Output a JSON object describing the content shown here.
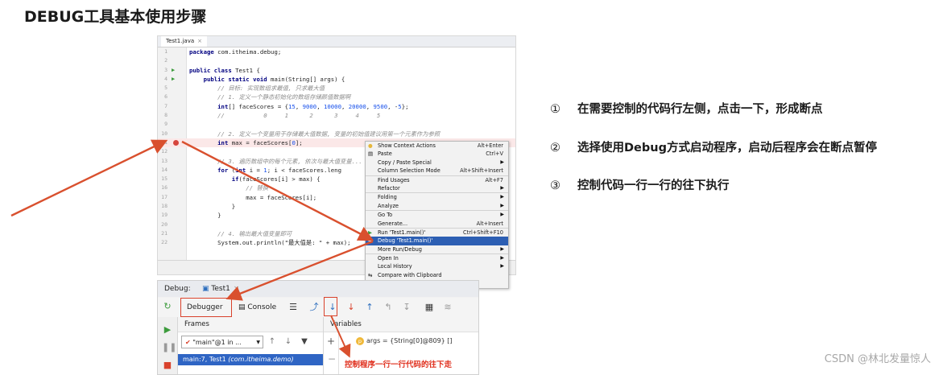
{
  "title": "DEBUG工具基本使用步骤",
  "ide": {
    "tab": "Test1.java",
    "lines": [
      {
        "n": "1",
        "html": "<span class=\"kw\">package</span> com.itheima.debug;"
      },
      {
        "n": "2",
        "html": ""
      },
      {
        "n": "3",
        "html": "<span class=\"kw\">public class</span> Test1 {",
        "run": true
      },
      {
        "n": "4",
        "html": "    <span class=\"kw\">public static void</span> main(String[] args) {",
        "run": true
      },
      {
        "n": "5",
        "html": "        <span class=\"cm\">// 目标: 实现数组求最值, 只求最大值</span>"
      },
      {
        "n": "6",
        "html": "        <span class=\"cm\">// 1. 定义一个静态初始化的数组存储颜值数据啊</span>"
      },
      {
        "n": "7",
        "html": "        <span class=\"kw\">int</span>[] faceScores = {<span class=\"num\">15</span>, <span class=\"num\">9000</span>, <span class=\"num\">10000</span>, <span class=\"num\">20000</span>, <span class=\"num\">9500</span>, -<span class=\"num\">5</span>};"
      },
      {
        "n": "8",
        "html": "        <span class=\"cm\">//           0     1      2      3     4     5</span>"
      },
      {
        "n": "9",
        "html": ""
      },
      {
        "n": "10",
        "html": "        <span class=\"cm\">// 2. 定义一个变量用于存储最大值数据, 变量的初始值建议用第一个元素作为参照</span>"
      },
      {
        "n": "11",
        "html": "        <span class=\"kw\">int</span> <span class=\"hl\">max</span> = faceScores[<span class=\"num\">0</span>];",
        "bp": true
      },
      {
        "n": "12",
        "html": ""
      },
      {
        "n": "13",
        "html": "        <span class=\"cm\">// 3. 遍历数组中的每个元素, 依次与最大值变量...</span>"
      },
      {
        "n": "14",
        "html": "        <span class=\"kw\">for</span> (<span class=\"kw\">int</span> i = <span class=\"num\">1</span>; i < faceScores.leng"
      },
      {
        "n": "15",
        "html": "            <span class=\"kw\">if</span>(faceScores[i] > max) {"
      },
      {
        "n": "16",
        "html": "                <span class=\"cm\">// 替换</span>"
      },
      {
        "n": "17",
        "html": "                max = faceScores[i];"
      },
      {
        "n": "18",
        "html": "            }"
      },
      {
        "n": "19",
        "html": "        }"
      },
      {
        "n": "20",
        "html": ""
      },
      {
        "n": "21",
        "html": "        <span class=\"cm\">// 4. 输出最大值变量即可</span>"
      },
      {
        "n": "22",
        "html": "        System.out.println(\"最大值是: \" + max);"
      }
    ]
  },
  "context_menu": [
    {
      "label": "Show Context Actions",
      "shortcut": "Alt+Enter",
      "icon": "bulb-icon"
    },
    {
      "label": "Paste",
      "shortcut": "Ctrl+V",
      "icon": "paste-icon"
    },
    {
      "label": "Copy / Paste Special",
      "arrow": true
    },
    {
      "label": "Column Selection Mode",
      "shortcut": "Alt+Shift+Insert"
    },
    {
      "label": "Find Usages",
      "shortcut": "Alt+F7",
      "sep": true
    },
    {
      "label": "Refactor",
      "arrow": true
    },
    {
      "label": "Folding",
      "arrow": true,
      "sep": true
    },
    {
      "label": "Analyze",
      "arrow": true
    },
    {
      "label": "Go To",
      "arrow": true,
      "sep": true
    },
    {
      "label": "Generate...",
      "shortcut": "Alt+Insert"
    },
    {
      "label": "Run 'Test1.main()'",
      "shortcut": "Ctrl+Shift+F10",
      "icon": "run-icon",
      "sep": true
    },
    {
      "label": "Debug 'Test1.main()'",
      "selected": true,
      "icon": "debug-icon"
    },
    {
      "label": "More Run/Debug",
      "arrow": true
    },
    {
      "label": "Open In",
      "arrow": true,
      "sep": true
    },
    {
      "label": "Local History",
      "arrow": true
    },
    {
      "label": "Compare with Clipboard",
      "icon": "compare-icon"
    }
  ],
  "debug_panel": {
    "label": "Debug:",
    "tab": "Test1",
    "debugger_tab": "Debugger",
    "console_tab": "Console",
    "frames_header": "Frames",
    "variables_header": "Variables",
    "thread": "\"main\"@1 in ...",
    "frame_row": "main:7, Test1",
    "frame_row_pkg": "(com.itheima.demo)",
    "var_badge": "p",
    "var_row": "args = {String[0]@809} []"
  },
  "annotation": "控制程序一行一行代码的往下走",
  "steps": [
    {
      "num": "①",
      "text": "在需要控制的代码行左侧，点击一下，形成断点"
    },
    {
      "num": "②",
      "text": "选择使用Debug方式启动程序，启动后程序会在断点暂停"
    },
    {
      "num": "③",
      "text": "控制代码一行一行的往下执行"
    }
  ],
  "watermark": "CSDN @林北发量惊人",
  "colors": {
    "arrow": "#d9502e",
    "selection": "#2d5fb3",
    "breakpoint": "#d6453d"
  }
}
